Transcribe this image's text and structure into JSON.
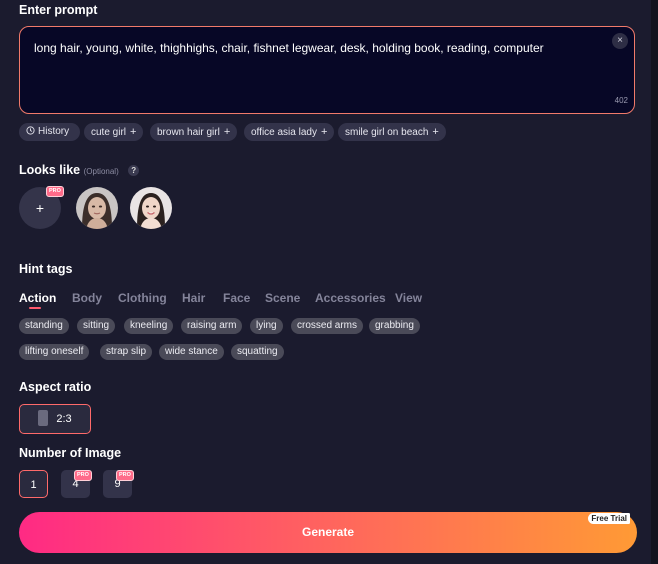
{
  "prompt": {
    "title": "Enter prompt",
    "text": "long hair, young, white, thighhighs, chair, fishnet legwear, desk, holding book, reading, computer",
    "clear_icon": "×",
    "count": "402"
  },
  "history_label": "History",
  "suggestions": [
    "cute girl",
    "brown hair girl",
    "office asia lady",
    "smile girl on beach"
  ],
  "looks_like": {
    "title": "Looks like",
    "optional": "(Optional)",
    "help": "?",
    "add": "+",
    "pro": "PRO"
  },
  "hint_tags": {
    "title": "Hint tags",
    "tabs": [
      "Action",
      "Body",
      "Clothing",
      "Hair",
      "Face",
      "Scene",
      "Accessories",
      "View"
    ],
    "active_tab": "Action",
    "tags": [
      "standing",
      "sitting",
      "kneeling",
      "raising arm",
      "lying",
      "crossed arms",
      "grabbing",
      "lifting oneself",
      "strap slip",
      "wide stance",
      "squatting"
    ]
  },
  "aspect_ratio": {
    "title": "Aspect ratio",
    "selected": "2:3"
  },
  "number_of_image": {
    "title": "Number of Image",
    "options": [
      "1",
      "4",
      "9"
    ],
    "selected": "1",
    "pro": "PRO"
  },
  "generate": {
    "label": "Generate",
    "badge": "Free Trial"
  },
  "colors": {
    "accent": "#ff5a6e",
    "gradient_start": "#ff2a84",
    "gradient_end": "#ff9a35"
  }
}
